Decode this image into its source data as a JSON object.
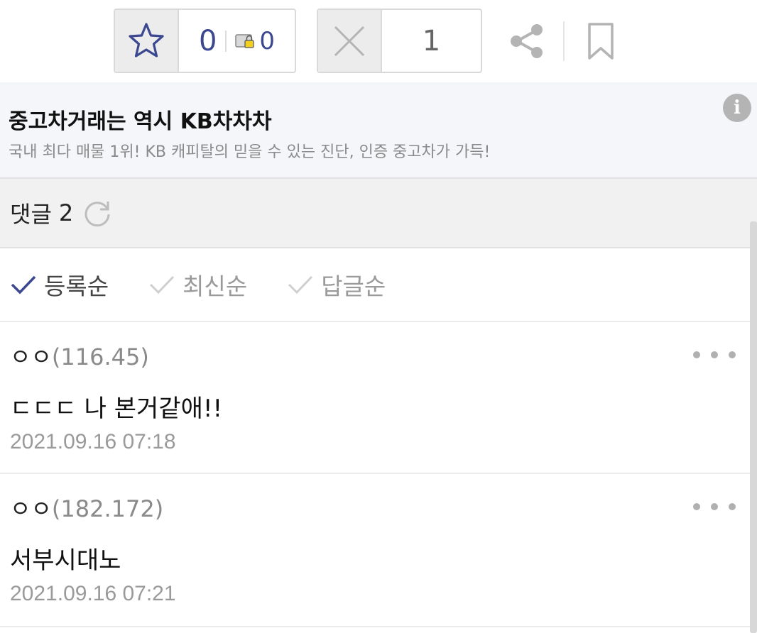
{
  "actions": {
    "upvote_count": "0",
    "fixed_upvote_count": "0",
    "downvote_count": "1"
  },
  "ad": {
    "title": "중고차거래는 역시 KB차차차",
    "description": "국내 최다 매물 1위! KB 캐피탈의 믿을 수 있는 진단, 인증 중고차가 가득!"
  },
  "comments_header": {
    "label": "댓글",
    "count": "2"
  },
  "sort_tabs": [
    {
      "label": "등록순",
      "active": true
    },
    {
      "label": "최신순",
      "active": false
    },
    {
      "label": "답글순",
      "active": false
    }
  ],
  "comments": [
    {
      "author": "ㅇㅇ",
      "ip": "(116.45)",
      "text": "ㄷㄷㄷ 나 본거같애!!",
      "date": "2021.09.16 07:18"
    },
    {
      "author": "ㅇㅇ",
      "ip": "(182.172)",
      "text": "서부시대노",
      "date": "2021.09.16 07:21"
    }
  ],
  "colors": {
    "accent": "#3b4890",
    "muted": "#9a9a9a",
    "banner_bg": "#f4f6f9",
    "header_bg": "#f1f1f1"
  },
  "icons": [
    "star-icon",
    "fixed-star-icon",
    "x-icon",
    "share-icon",
    "bookmark-icon",
    "info-icon",
    "refresh-icon",
    "check-icon",
    "more-icon"
  ]
}
